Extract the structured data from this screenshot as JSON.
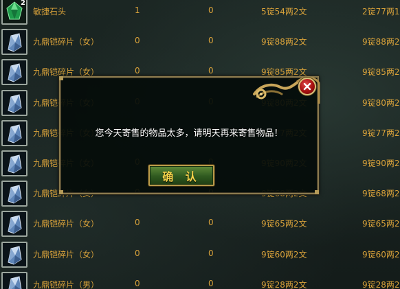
{
  "items": [
    {
      "icon": "green-gem-icon",
      "stack": "2",
      "name": "敏捷石头",
      "n1": "1",
      "n2": "0",
      "price1": "5锭54两2文",
      "price2": "2锭77两1"
    },
    {
      "icon": "crystal-shard-icon",
      "stack": "",
      "name": "九鼎铠碎片（女）",
      "n1": "0",
      "n2": "0",
      "price1": "9锭88两2文",
      "price2": "9锭88两2"
    },
    {
      "icon": "crystal-shard-icon",
      "stack": "",
      "name": "九鼎铠碎片（女）",
      "n1": "0",
      "n2": "0",
      "price1": "9锭85两2文",
      "price2": "9锭85两2"
    },
    {
      "icon": "crystal-shard-icon",
      "stack": "",
      "name": "九鼎铠碎片（女）",
      "n1": "0",
      "n2": "0",
      "price1": "9锭80两2文",
      "price2": "9锭80两2"
    },
    {
      "icon": "crystal-shard-icon",
      "stack": "",
      "name": "九鼎铠碎片（女）",
      "n1": "0",
      "n2": "0",
      "price1": "9锭77两2文",
      "price2": "9锭77两2"
    },
    {
      "icon": "crystal-shard-icon",
      "stack": "",
      "name": "九鼎铠碎片（女）",
      "n1": "0",
      "n2": "0",
      "price1": "9锭90两2文",
      "price2": "9锭90两2"
    },
    {
      "icon": "crystal-shard-icon",
      "stack": "",
      "name": "九鼎铠碎片（女）",
      "n1": "0",
      "n2": "0",
      "price1": "9锭68两2文",
      "price2": "9锭68两2"
    },
    {
      "icon": "crystal-shard-icon",
      "stack": "",
      "name": "九鼎铠碎片（女）",
      "n1": "0",
      "n2": "0",
      "price1": "9锭65两2文",
      "price2": "9锭65两2"
    },
    {
      "icon": "crystal-shard-icon",
      "stack": "",
      "name": "九鼎铠碎片（女）",
      "n1": "0",
      "n2": "0",
      "price1": "9锭60两2文",
      "price2": "9锭60两2"
    },
    {
      "icon": "crystal-shard-icon",
      "stack": "",
      "name": "九鼎铠碎片（男）",
      "n1": "0",
      "n2": "0",
      "price1": "9锭28两2文",
      "price2": "9锭28两2"
    }
  ],
  "dialog": {
    "message": "您今天寄售的物品太多，请明天再来寄售物品！",
    "ok_label": "确 认",
    "close_icon": "close-x-icon"
  },
  "colors": {
    "text_orange": "#d9a23a",
    "dialog_border": "#8a7a4e",
    "button_green": "#2f5a20",
    "close_red": "#a41010"
  }
}
